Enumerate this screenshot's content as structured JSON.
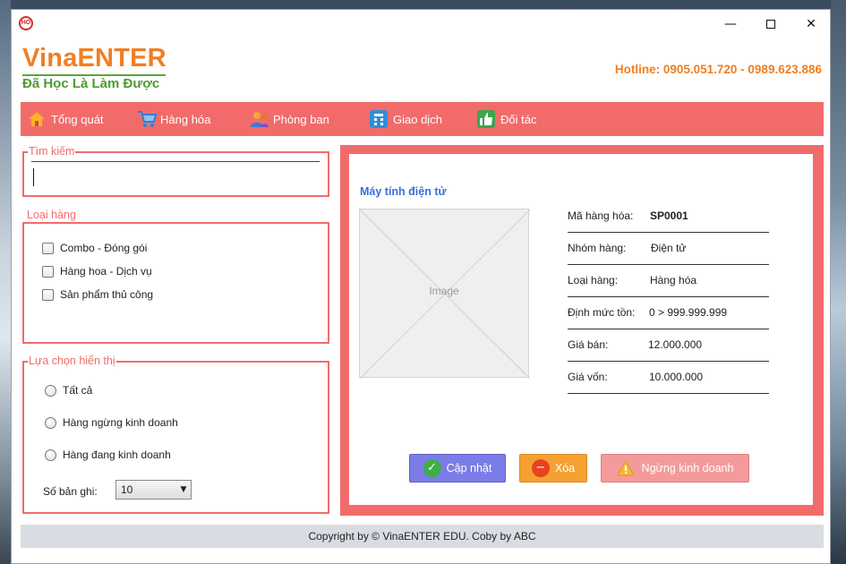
{
  "window": {
    "icon_text": "HO",
    "controls": {
      "minimize": "—",
      "maximize": "",
      "close": "✕"
    }
  },
  "header": {
    "brand": "VinaENTER",
    "slogan": "Đã Học Là Làm Được",
    "hotline": "Hotline: 0905.051.720 - 0989.623.886"
  },
  "nav": {
    "items": [
      {
        "label": "Tổng quát",
        "icon": "home-icon"
      },
      {
        "label": "Hàng hóa",
        "icon": "cart-icon"
      },
      {
        "label": "Phòng ban",
        "icon": "people-icon"
      },
      {
        "label": "Giao dịch",
        "icon": "calculator-icon"
      },
      {
        "label": "Đối tác",
        "icon": "handshake-icon"
      }
    ]
  },
  "search": {
    "legend": "Tìm kiếm",
    "value": "",
    "placeholder": ""
  },
  "category": {
    "legend": "Loại hàng",
    "options": [
      "Combo - Đóng gói",
      "Hàng hoa - Dịch vụ",
      "Sản phẩm thủ công"
    ]
  },
  "display": {
    "legend": "Lựa chọn hiển thị",
    "options": [
      "Tất cả",
      "Hàng ngừng kinh doanh",
      "Hàng đang kinh doanh"
    ],
    "records_label": "Số bản ghi:",
    "records_value": "10"
  },
  "detail": {
    "product_name": "Máy tính điện tử",
    "image_placeholder": "Image",
    "fields": [
      {
        "label": "Mã hàng hóa:",
        "value": "SP0001"
      },
      {
        "label": "Nhóm hàng:",
        "value": "Điện tử"
      },
      {
        "label": "Loại hàng:",
        "value": "Hàng hóa"
      },
      {
        "label": "Định mức tồn:",
        "value": "0 > 999.999.999"
      },
      {
        "label": "Giá bán:",
        "value": "12.000.000"
      },
      {
        "label": "Giá vốn:",
        "value": "10.000.000"
      }
    ],
    "buttons": {
      "update": "Cập nhật",
      "delete": "Xóa",
      "stop": "Ngừng kinh doanh"
    }
  },
  "footer": {
    "text": "Copyright by © VinaENTER EDU. Coby by ABC"
  },
  "colors": {
    "accent": "#f26b6b",
    "brand_orange": "#f07f22",
    "brand_green": "#4f9a32",
    "product_title": "#3a6fd8"
  }
}
